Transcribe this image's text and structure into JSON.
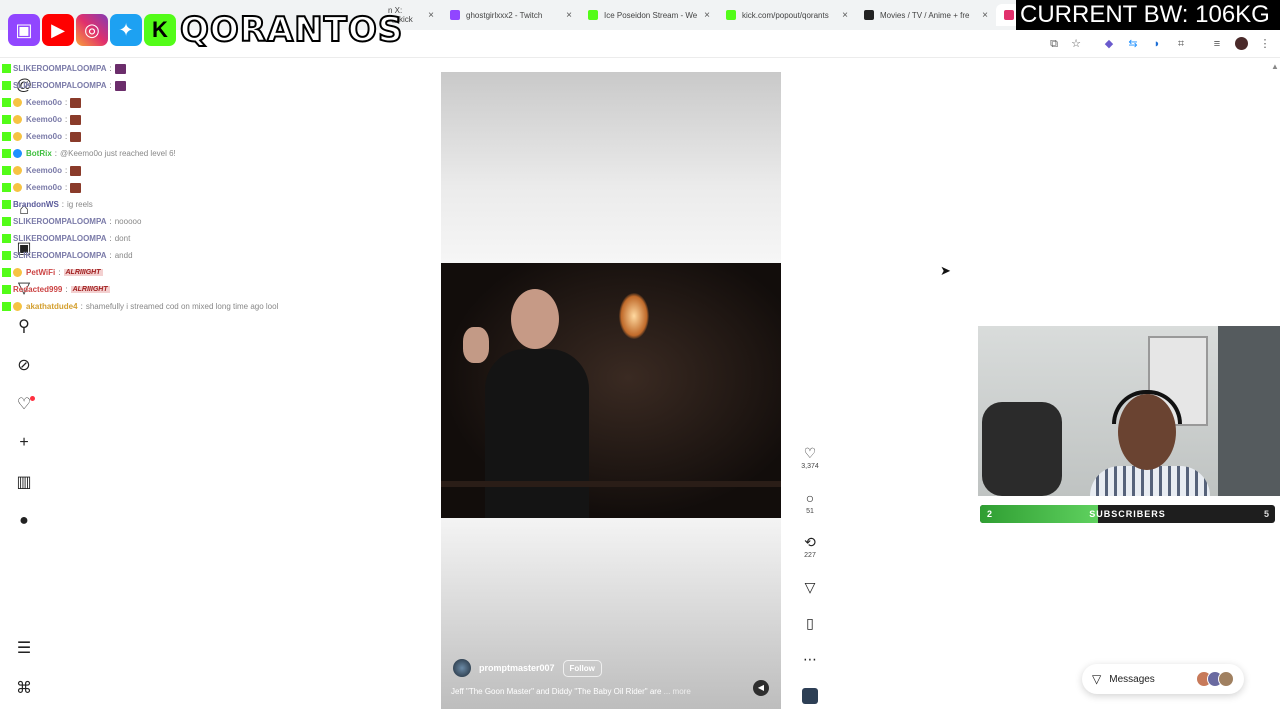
{
  "overlay": {
    "brand_name": "QORANTOS",
    "social_icons": [
      "twitch-icon",
      "youtube-icon",
      "instagram-icon",
      "twitter-icon",
      "kick-icon"
    ],
    "bw_banner": "CURRENT BW: 106KG"
  },
  "browser": {
    "tabs": [
      {
        "title": "n X: \"@kick",
        "active": false
      },
      {
        "title": "ghostgirlxxx2 - Twitch",
        "active": false
      },
      {
        "title": "Ice Poseidon Stream - We",
        "active": false
      },
      {
        "title": "kick.com/popout/qorants",
        "active": false
      },
      {
        "title": "Movies / TV / Anime + fre",
        "active": false
      }
    ],
    "toolbar_icons": [
      "cast-icon",
      "star-icon",
      "extension-icon",
      "translate-icon",
      "extension-icon",
      "puzzle-icon",
      "media-icon",
      "menu-icon"
    ]
  },
  "chat": [
    {
      "user": "SLIKEROOMPALOOMPA",
      "msg": "",
      "emote": true
    },
    {
      "user": "SLIKEROOMPALOOMPA",
      "msg": "",
      "emote": true
    },
    {
      "user": "Keemo0o",
      "msg": "",
      "emote": true
    },
    {
      "user": "Keemo0o",
      "msg": "",
      "emote": true
    },
    {
      "user": "Keemo0o",
      "msg": "",
      "emote": true
    },
    {
      "user": "BotRix",
      "msg": "@Keemo0o just reached level 6!",
      "emote": false
    },
    {
      "user": "Keemo0o",
      "msg": "",
      "emote": true
    },
    {
      "user": "Keemo0o",
      "msg": "",
      "emote": true
    },
    {
      "user": "BrandonWS",
      "msg": "ig reels",
      "emote": false
    },
    {
      "user": "SLIKEROOMPALOOMPA",
      "msg": "nooooo",
      "emote": false
    },
    {
      "user": "SLIKEROOMPALOOMPA",
      "msg": "dont",
      "emote": false
    },
    {
      "user": "SLIKEROOMPALOOMPA",
      "msg": "andd",
      "emote": false
    },
    {
      "user": "PetWiFi",
      "msg": "",
      "emote_text": "ALRIIIGHT"
    },
    {
      "user": "Redacted999",
      "msg": "",
      "emote_text": "ALRIIIGHT"
    },
    {
      "user": "akathatdude4",
      "msg": "shamefully i streamed cod on mixed long time ago lool",
      "emote": false
    }
  ],
  "nav_icons": [
    "threads-icon",
    "home-icon",
    "reels-icon",
    "send-icon",
    "search-icon",
    "explore-icon",
    "heart-icon",
    "create-icon",
    "dashboard-icon",
    "profile-icon",
    "menu-icon",
    "more-apps-icon"
  ],
  "reel": {
    "author": "promptmaster007",
    "follow_label": "Follow",
    "caption": "Jeff \"The Goon Master\" and Diddy \"The Baby Oil Rider\" are",
    "more_label": "... more",
    "likes": "3,374",
    "comments": "51",
    "reposts": "227"
  },
  "webcam_bar": {
    "label": "SUBSCRIBERS",
    "current": "2",
    "goal": "5",
    "progress": 0.4
  },
  "messages_label": "Messages",
  "colors": {
    "kick_green": "#53fc18",
    "twitch_purple": "#9146ff",
    "youtube_red": "#ff0000",
    "notif_red": "#ff3040",
    "progress_green": "#3cb043"
  }
}
